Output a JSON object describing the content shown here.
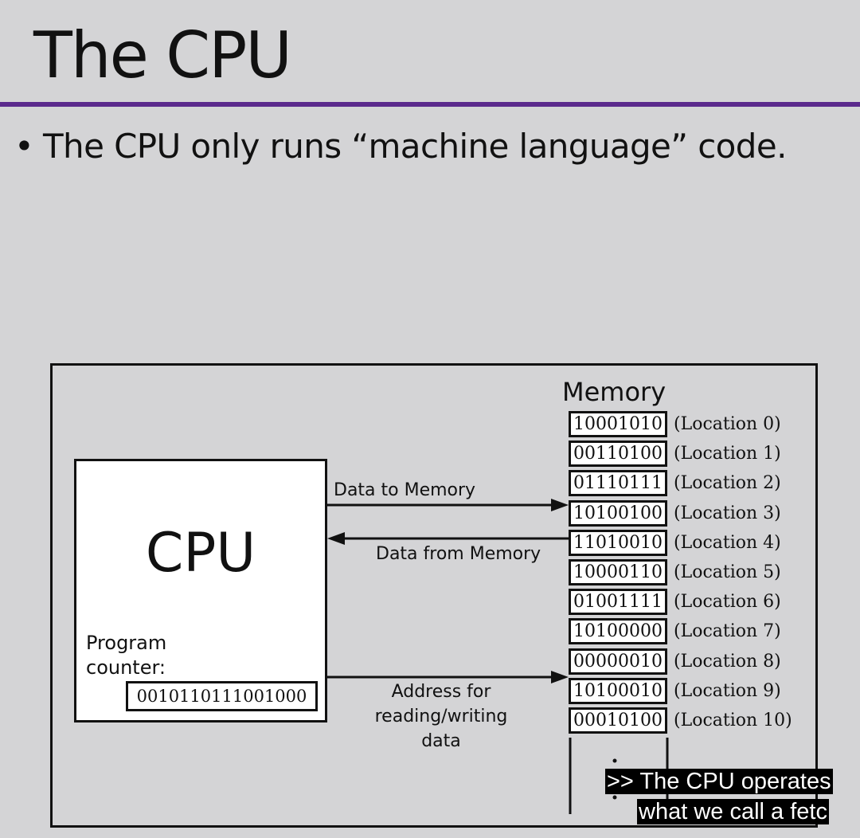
{
  "slide": {
    "title": "The CPU",
    "bullets": [
      "The CPU only runs “machine language” code."
    ]
  },
  "diagram": {
    "cpu_label": "CPU",
    "program_counter_label": "Program\ncounter:",
    "program_counter_value": "0010110111001000",
    "memory_title": "Memory",
    "memory_cells": [
      {
        "value": "10001010",
        "location": "(Location 0)"
      },
      {
        "value": "00110100",
        "location": "(Location 1)"
      },
      {
        "value": "01110111",
        "location": "(Location 2)"
      },
      {
        "value": "10100100",
        "location": "(Location 3)"
      },
      {
        "value": "11010010",
        "location": "(Location 4)"
      },
      {
        "value": "10000110",
        "location": "(Location 5)"
      },
      {
        "value": "01001111",
        "location": "(Location 6)"
      },
      {
        "value": "10100000",
        "location": "(Location 7)"
      },
      {
        "value": "00000010",
        "location": "(Location 8)"
      },
      {
        "value": "10100010",
        "location": "(Location 9)"
      },
      {
        "value": "00010100",
        "location": "(Location 10)"
      }
    ],
    "arrows": {
      "to_memory": "Data to Memory",
      "from_memory": "Data from Memory",
      "address": "Address for\nreading/writing\ndata"
    }
  },
  "caption": {
    "line1": ">> The CPU operates",
    "line2": "what we call a fetc"
  },
  "colors": {
    "title_rule": "#5b2a8c",
    "background": "#d4d4d6"
  }
}
